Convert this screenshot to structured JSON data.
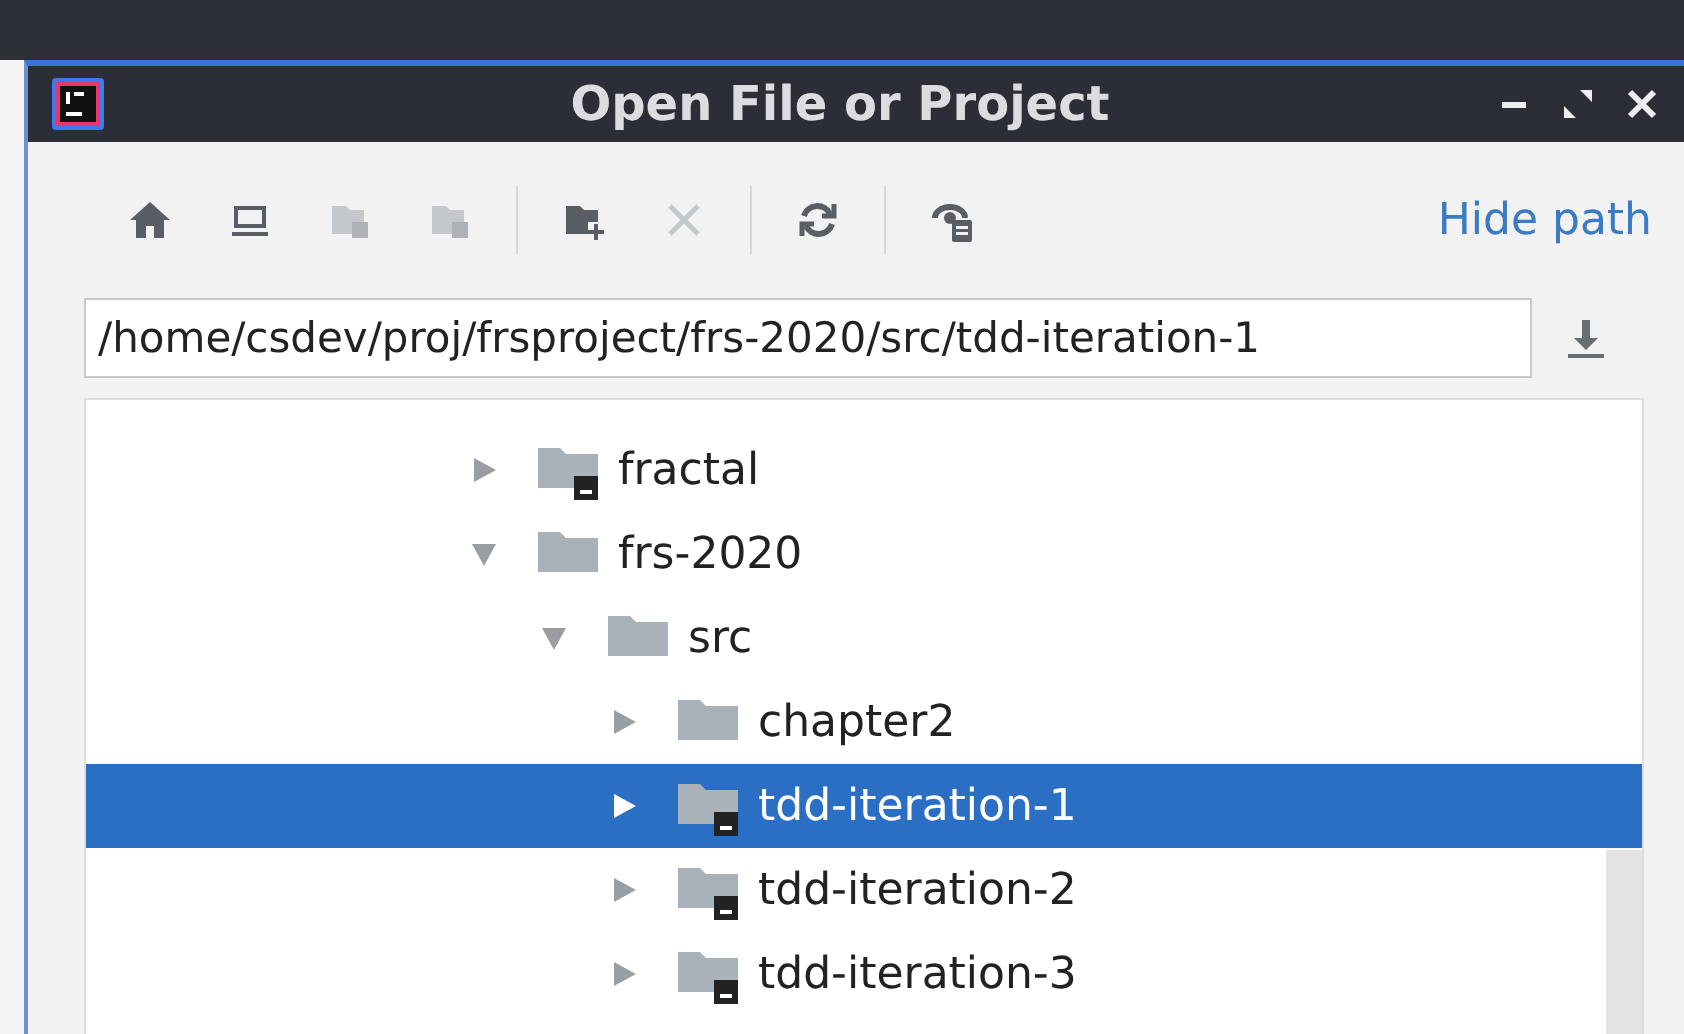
{
  "window": {
    "title": "Open File or Project"
  },
  "toolbar": [
    {
      "kind": "home",
      "disabled": false
    },
    {
      "kind": "desktop",
      "disabled": false
    },
    {
      "kind": "project",
      "disabled": true
    },
    {
      "kind": "module",
      "disabled": true
    },
    {
      "kind": "separator"
    },
    {
      "kind": "new-folder",
      "disabled": false
    },
    {
      "kind": "delete",
      "disabled": true
    },
    {
      "kind": "separator"
    },
    {
      "kind": "refresh",
      "disabled": false
    },
    {
      "kind": "separator"
    },
    {
      "kind": "show-hidden",
      "disabled": false
    }
  ],
  "hide_path_link": "Hide path",
  "path_field": {
    "value": "/home/csdev/proj/frsproject/frs-2020/src/tdd-iteration-1"
  },
  "tree": [
    {
      "label": "fractal",
      "expanded": false,
      "module": true,
      "selected": false
    },
    {
      "label": "frs-2020",
      "expanded": true,
      "module": false,
      "selected": false,
      "children": [
        {
          "label": "src",
          "expanded": true,
          "module": false,
          "selected": false,
          "children": [
            {
              "label": "chapter2",
              "expanded": false,
              "module": false,
              "selected": false
            },
            {
              "label": "tdd-iteration-1",
              "expanded": false,
              "module": true,
              "selected": true
            },
            {
              "label": "tdd-iteration-2",
              "expanded": false,
              "module": true,
              "selected": false
            },
            {
              "label": "tdd-iteration-3",
              "expanded": false,
              "module": true,
              "selected": false
            }
          ]
        }
      ]
    }
  ]
}
